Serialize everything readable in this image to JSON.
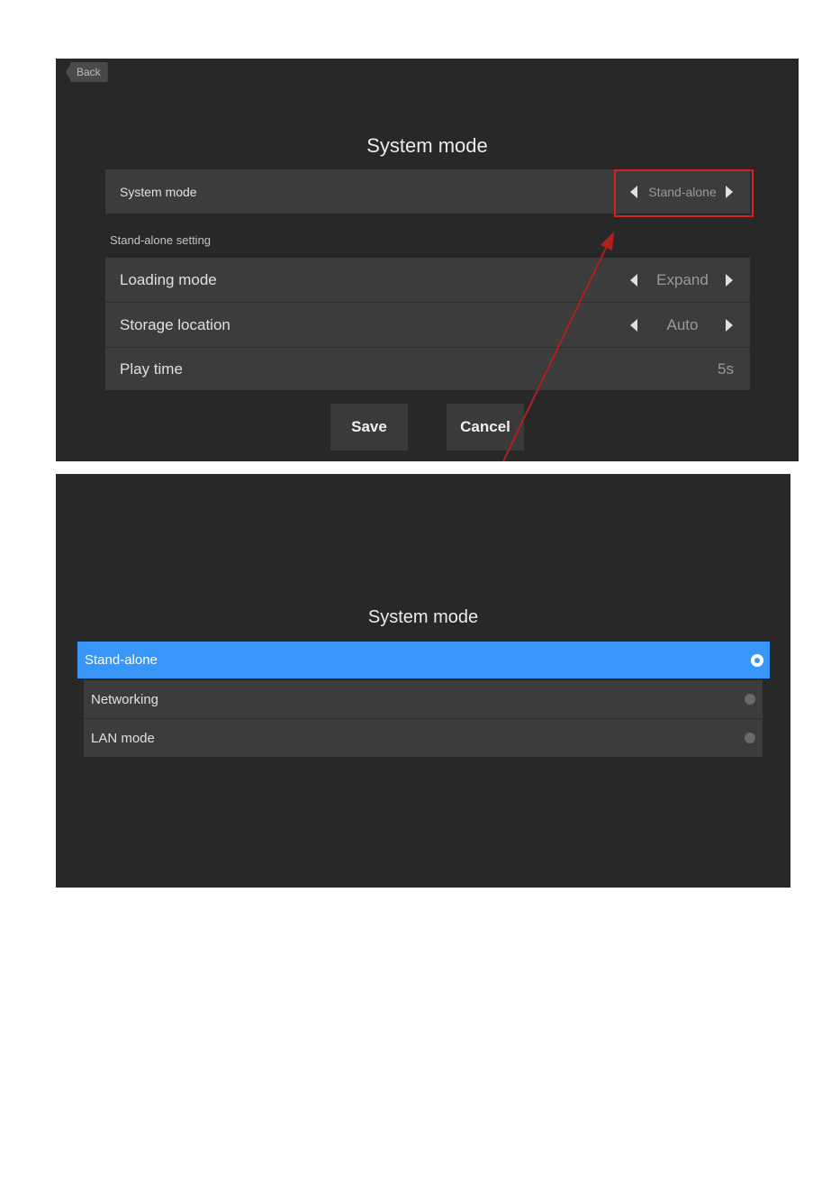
{
  "screen1": {
    "back_label": "Back",
    "title": "System mode",
    "system_mode_row": {
      "label": "System mode",
      "value": "Stand-alone"
    },
    "section_label": "Stand-alone setting",
    "rows": [
      {
        "label": "Loading mode",
        "value": "Expand"
      },
      {
        "label": "Storage location",
        "value": "Auto"
      },
      {
        "label": "Play time",
        "value": "5s"
      }
    ],
    "save_label": "Save",
    "cancel_label": "Cancel",
    "annotation_color": "#d22222"
  },
  "screen2": {
    "title": "System mode",
    "options": [
      {
        "label": "Stand-alone",
        "selected": true
      },
      {
        "label": "Networking",
        "selected": false
      },
      {
        "label": "LAN mode",
        "selected": false
      }
    ],
    "accent_color": "#3796f7"
  }
}
